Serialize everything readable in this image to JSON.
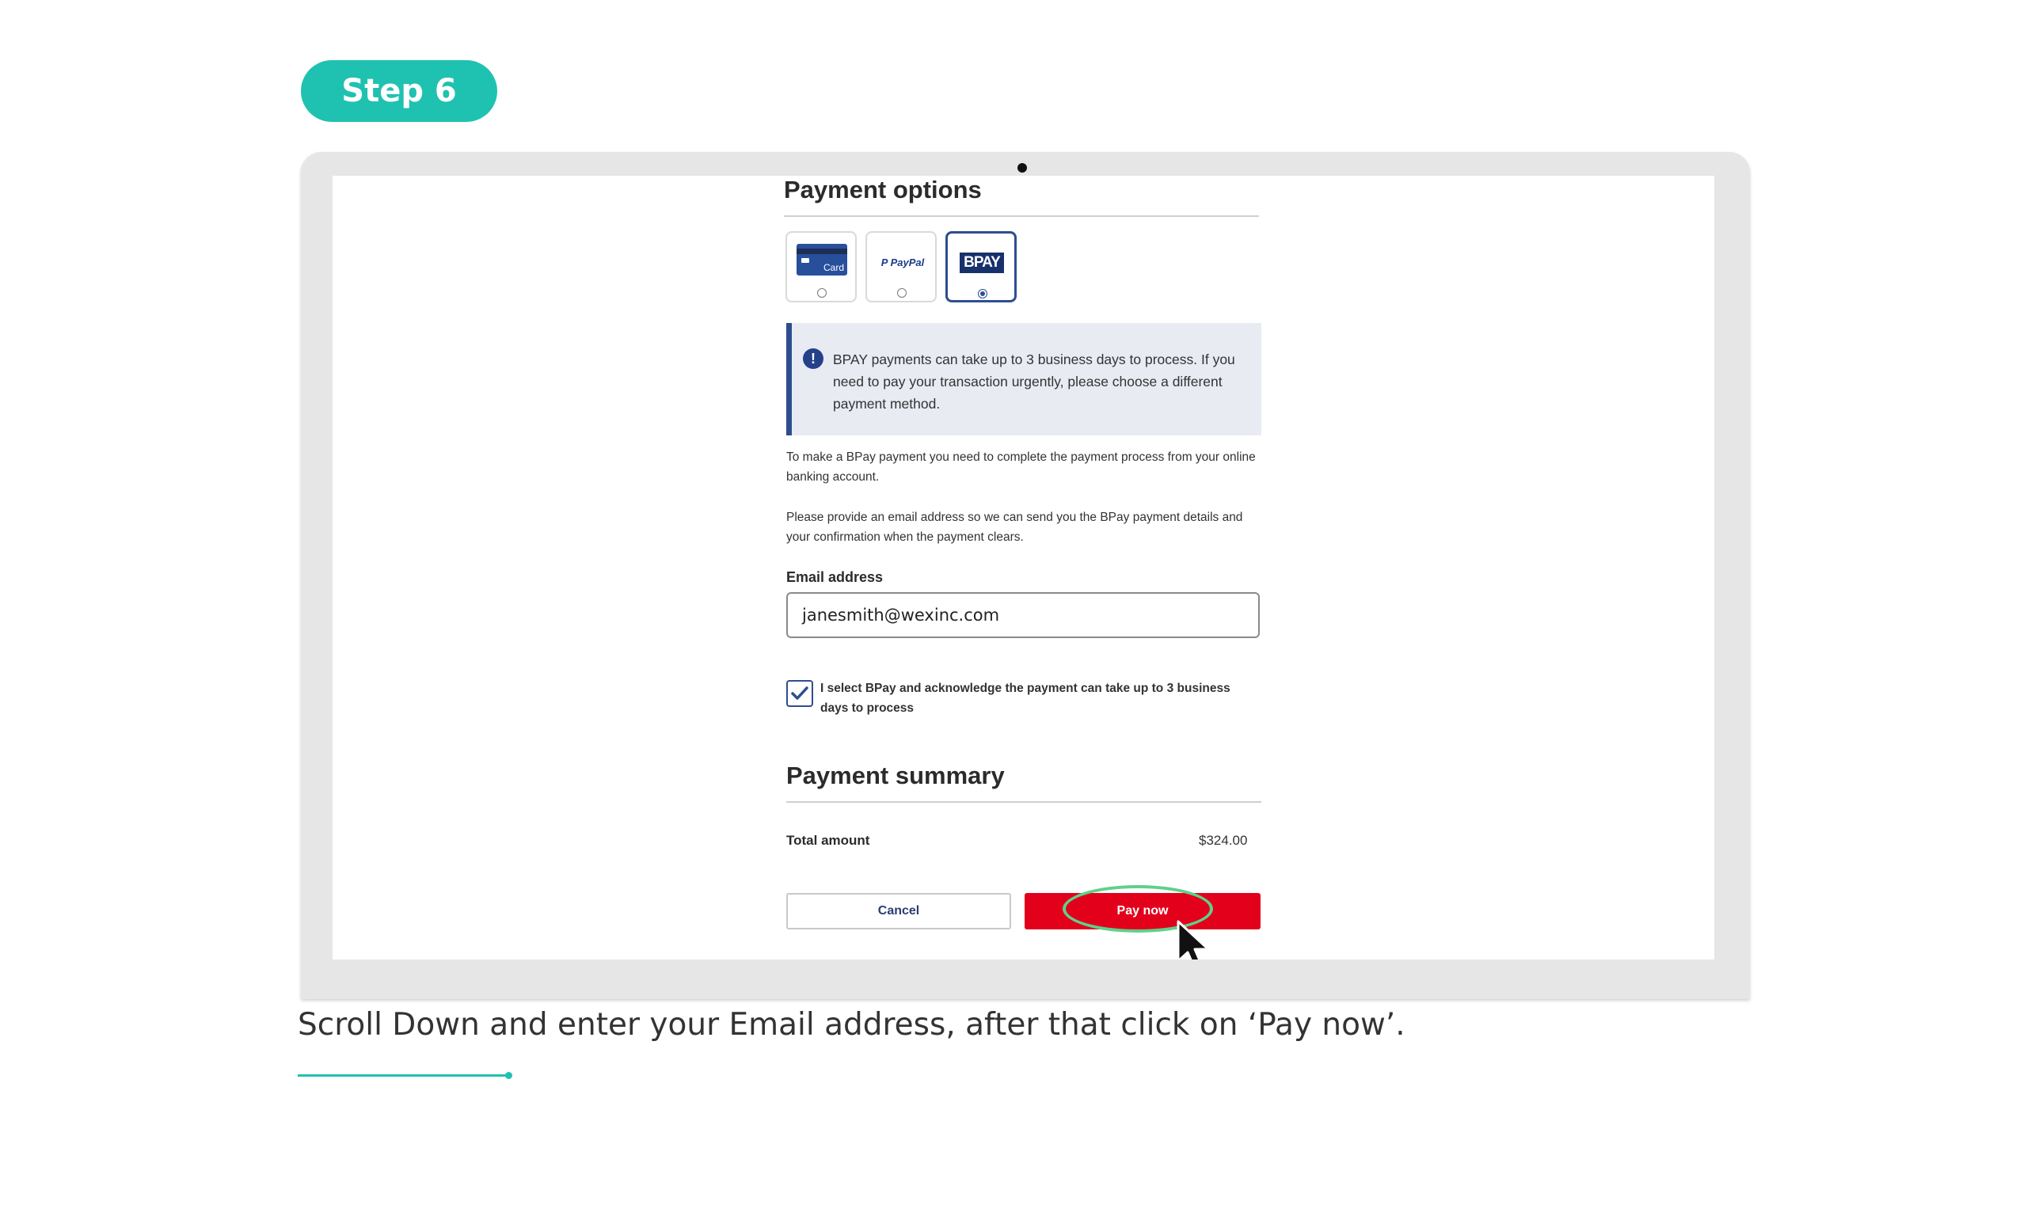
{
  "step": {
    "label": "Step 6"
  },
  "payment_options": {
    "title": "Payment options",
    "options": [
      {
        "name": "Card",
        "selected": false
      },
      {
        "name": "PayPal",
        "selected": false
      },
      {
        "name": "BPAY",
        "selected": true
      }
    ]
  },
  "notice": {
    "text": "BPAY payments can take up to 3 business days to process. If you need to pay your transaction urgently, please choose a different payment method."
  },
  "body": {
    "para1": "To make a BPay payment you need to complete the payment process from your online banking account.",
    "para2": "Please provide an email address so we can send you the BPay payment details and your confirmation when the payment clears."
  },
  "email": {
    "label": "Email address",
    "value": "janesmith@wexinc.com"
  },
  "acknowledge": {
    "checked": true,
    "text": "I select BPay and acknowledge the payment can take up to 3 business days to process"
  },
  "summary": {
    "title": "Payment summary",
    "total_label": "Total amount",
    "total_value": "$324.00"
  },
  "buttons": {
    "cancel": "Cancel",
    "pay_now": "Pay now"
  },
  "caption": "Scroll Down and enter your Email address, after that click on ‘Pay now’.",
  "colors": {
    "accent_teal": "#1fc2b0",
    "pay_red": "#e3001b",
    "bpay_navy": "#2d4e8f",
    "highlight_green": "#5fd08a"
  }
}
